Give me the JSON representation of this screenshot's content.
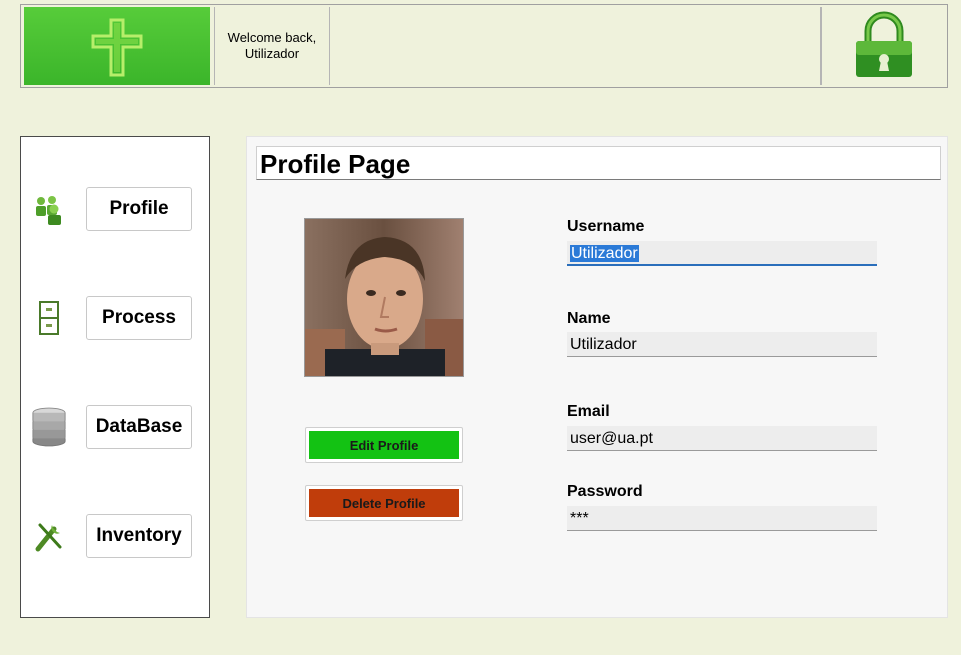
{
  "header": {
    "welcome_line1": "Welcome back,",
    "welcome_line2": "Utilizador",
    "logo_icon": "cross-icon",
    "lock_icon": "padlock-icon"
  },
  "sidebar": {
    "items": [
      {
        "label": "Profile",
        "icon": "users-icon"
      },
      {
        "label": "Process",
        "icon": "filing-cabinet-icon"
      },
      {
        "label": "DataBase",
        "icon": "database-icon"
      },
      {
        "label": "Inventory",
        "icon": "tools-icon"
      }
    ]
  },
  "main": {
    "title": "Profile Page",
    "edit_label": "Edit Profile",
    "delete_label": "Delete Profile",
    "fields": {
      "username": {
        "label": "Username",
        "value": "Utilizador"
      },
      "name": {
        "label": "Name",
        "value": "Utilizador"
      },
      "email": {
        "label": "Email",
        "value": "user@ua.pt"
      },
      "password": {
        "label": "Password",
        "value": "***"
      }
    }
  },
  "colors": {
    "background": "#eff2dc",
    "logo_green": "#45bd30",
    "edit_green": "#13c213",
    "delete_red": "#c03d0b",
    "focus_blue": "#2a6ebb"
  }
}
